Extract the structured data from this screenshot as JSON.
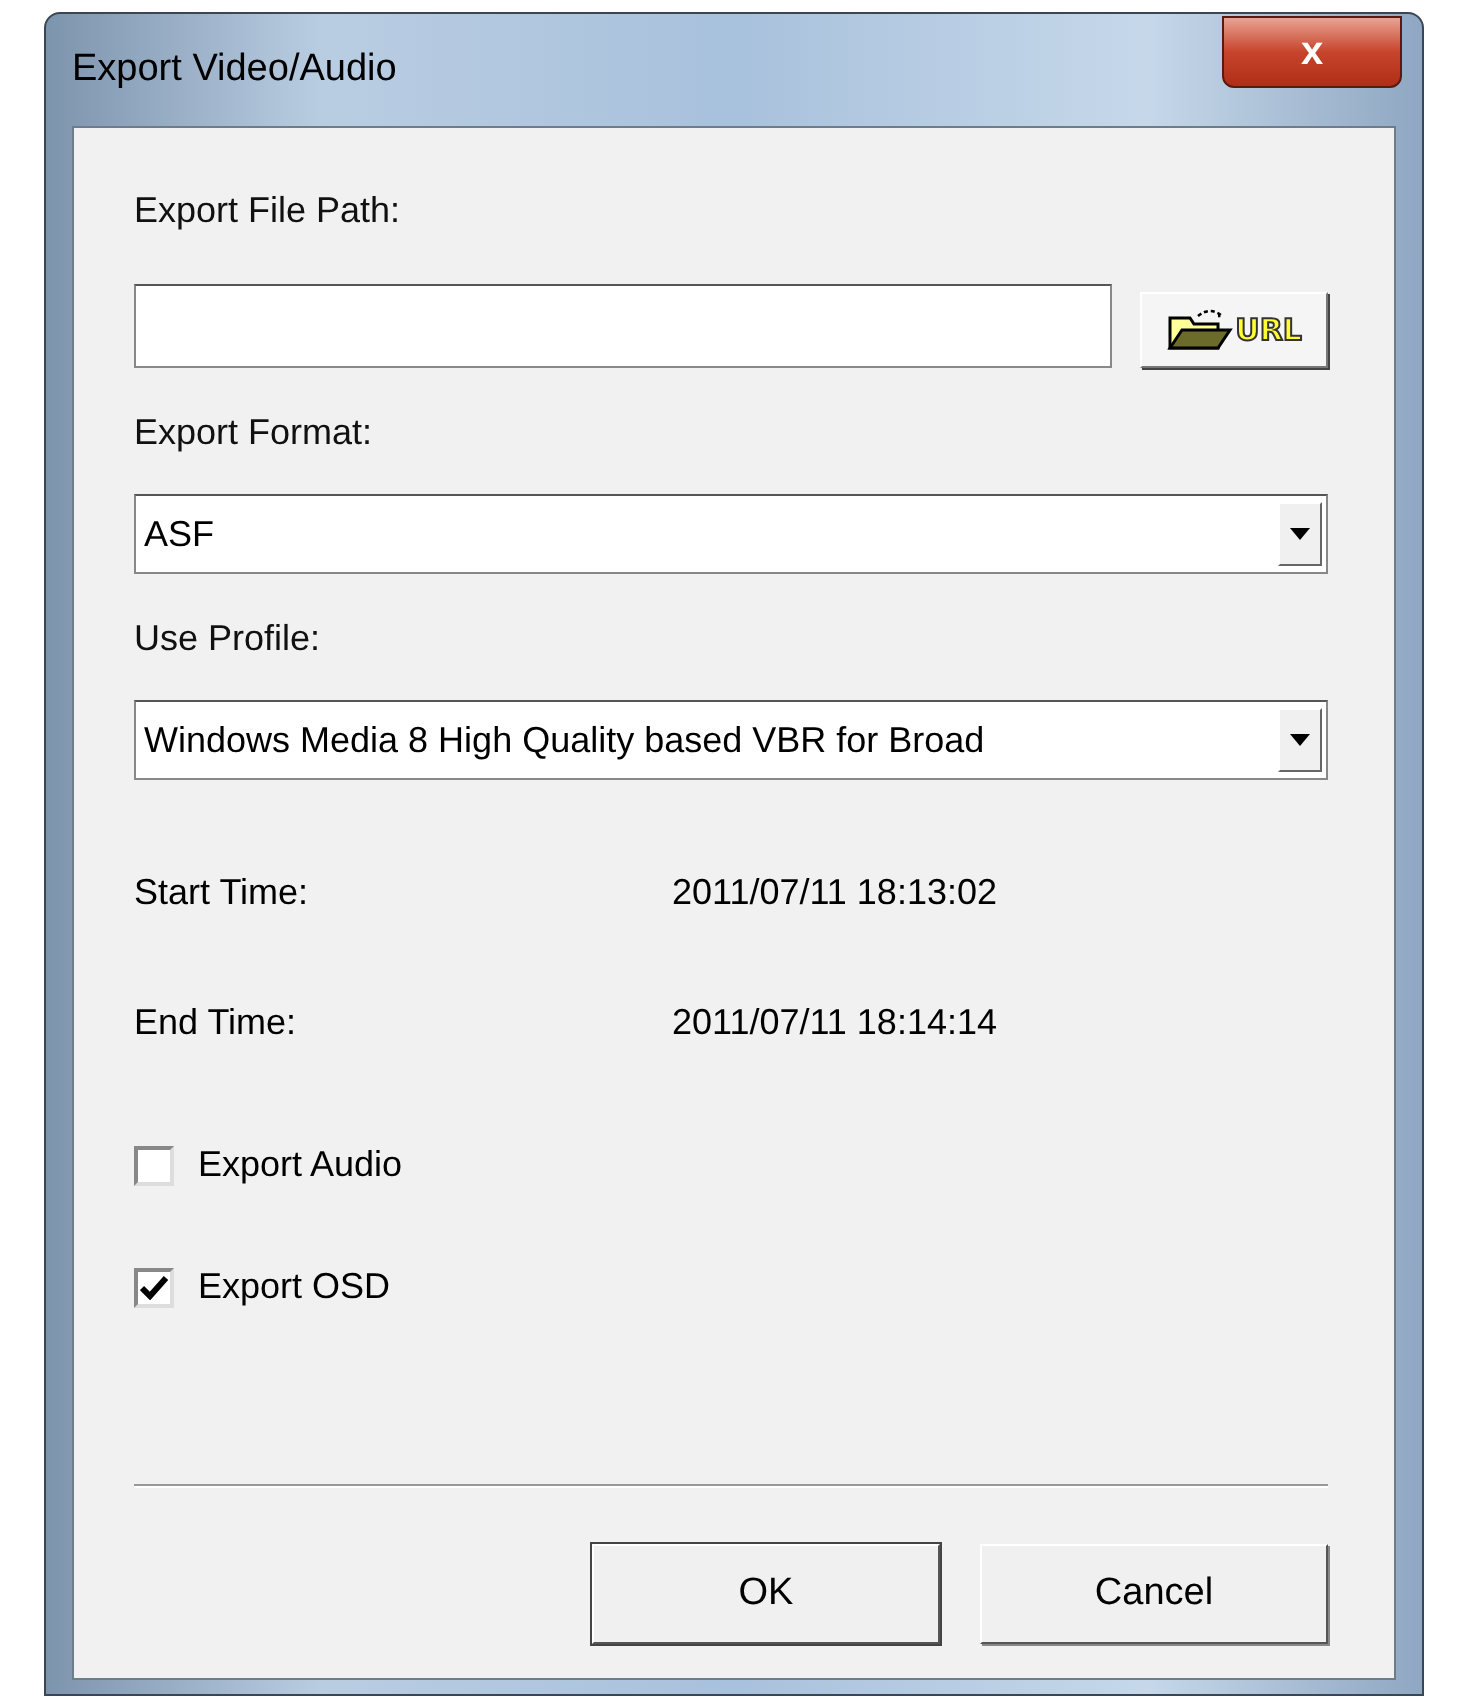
{
  "window": {
    "title": "Export Video/Audio",
    "close_glyph": "x"
  },
  "file_path": {
    "label": "Export File Path:",
    "browse_button": "URL"
  },
  "format": {
    "label": "Export Format:",
    "value": "ASF"
  },
  "profile": {
    "label": "Use Profile:",
    "value": "Windows Media 8 High Quality based VBR for Broad"
  },
  "times": [
    {
      "label": "Start Time:",
      "value": "2011/07/11 18:13:02"
    },
    {
      "label": "End Time:",
      "value": "2011/07/11 18:14:14"
    }
  ],
  "options": [
    {
      "label": "Export Audio",
      "checked": false
    },
    {
      "label": "Export OSD",
      "checked": true
    }
  ],
  "buttons": [
    {
      "label": "OK",
      "default": true
    },
    {
      "label": "Cancel",
      "default": false
    }
  ]
}
